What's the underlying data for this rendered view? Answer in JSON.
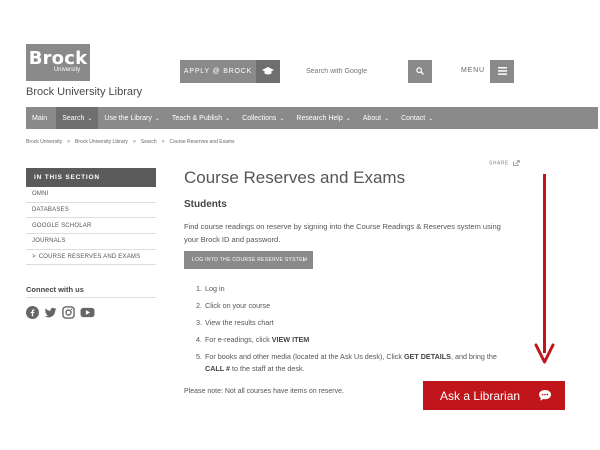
{
  "header": {
    "logo_word": "Brock",
    "logo_sub": "University",
    "site_title": "Brock University Library",
    "apply_label": "APPLY @ BROCK",
    "search_placeholder": "Search with Google",
    "menu_label": "MENU"
  },
  "nav": {
    "items": [
      {
        "label": "Main",
        "chevron": ""
      },
      {
        "label": "Search",
        "chevron": "⌄"
      },
      {
        "label": "Use the Library",
        "chevron": "⌄"
      },
      {
        "label": "Teach & Publish",
        "chevron": "⌄"
      },
      {
        "label": "Collections",
        "chevron": "⌄"
      },
      {
        "label": "Research Help",
        "chevron": "⌄"
      },
      {
        "label": "About",
        "chevron": "⌄"
      },
      {
        "label": "Contact",
        "chevron": "⌄"
      }
    ]
  },
  "breadcrumb": {
    "items": [
      "Brock University",
      "Brock University Library",
      "Search",
      "Course Reserves and Exams"
    ],
    "separator": ">"
  },
  "sidebar": {
    "section_title": "IN THIS SECTION",
    "items": [
      {
        "label": "OMNI",
        "arrow": ""
      },
      {
        "label": "DATABASES",
        "arrow": ""
      },
      {
        "label": "GOOGLE SCHOLAR",
        "arrow": ""
      },
      {
        "label": "JOURNALS",
        "arrow": ""
      },
      {
        "label": "COURSE RESERVES AND EXAMS",
        "arrow": ">"
      }
    ],
    "connect_title": "Connect with us"
  },
  "main": {
    "share_label": "SHARE",
    "title": "Course Reserves and Exams",
    "subheading": "Students",
    "intro": "Find course readings on reserve by signing into the Course Readings & Reserves system using your Brock ID and password.",
    "login_button": "LOG INTO THE COURSE RESERVE SYSTEM",
    "steps": [
      {
        "num": "1.",
        "pre": "Log in",
        "bold": "",
        "mid": "",
        "bold2": "",
        "post": ""
      },
      {
        "num": "2.",
        "pre": "Click on your course",
        "bold": "",
        "mid": "",
        "bold2": "",
        "post": ""
      },
      {
        "num": "3.",
        "pre": "View the results chart",
        "bold": "",
        "mid": "",
        "bold2": "",
        "post": ""
      },
      {
        "num": "4.",
        "pre": "For e-readings, click ",
        "bold": "VIEW ITEM",
        "mid": "",
        "bold2": "",
        "post": ""
      },
      {
        "num": "5.",
        "pre": "For books and other media (located at the Ask Us desk), Click ",
        "bold": "GET DETAILS",
        "mid": ", and bring the ",
        "bold2": "CALL #",
        "post": " to the staff at the desk."
      }
    ],
    "note": "Please note: Not all courses have items on reserve."
  },
  "ask": {
    "label": "Ask a Librarian"
  },
  "colors": {
    "header_gray": "#8a8a8a",
    "section_dark": "#5a5a5a",
    "accent_red": "#c0161b"
  },
  "icons": [
    "graduation-cap-icon",
    "search-icon",
    "hamburger-menu-icon",
    "share-icon",
    "facebook-icon",
    "twitter-icon",
    "instagram-icon",
    "youtube-icon",
    "chat-bubble-icon",
    "arrow-down-icon"
  ]
}
